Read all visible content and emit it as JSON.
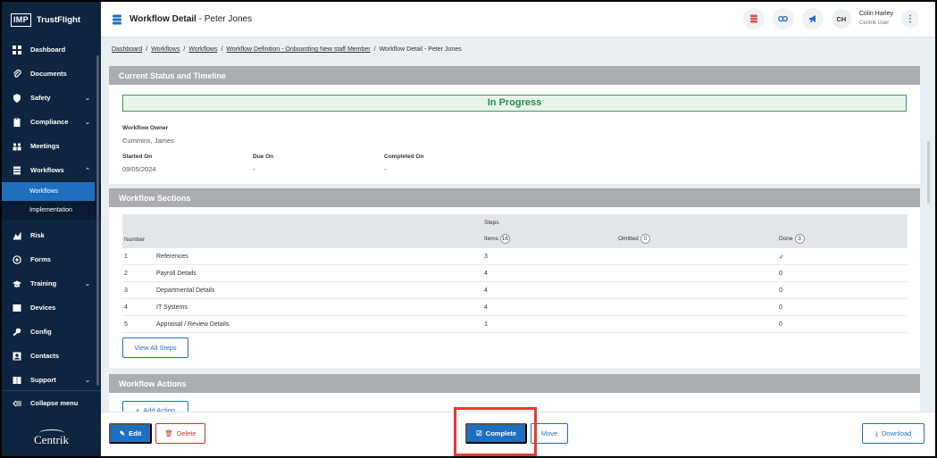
{
  "brand": {
    "logo": "IMP",
    "name": "TrustFlight"
  },
  "sidebar": {
    "items": [
      {
        "label": "Dashboard",
        "icon": "dashboard-icon"
      },
      {
        "label": "Documents",
        "icon": "paperclip-icon"
      },
      {
        "label": "Safety",
        "icon": "shield-icon",
        "chevron": "⌄"
      },
      {
        "label": "Compliance",
        "icon": "clipboard-icon",
        "chevron": "⌄"
      },
      {
        "label": "Meetings",
        "icon": "meetings-icon"
      },
      {
        "label": "Workflows",
        "icon": "workflows-icon",
        "chevron": "⌃"
      },
      {
        "label": "Risk",
        "icon": "risk-icon"
      },
      {
        "label": "Forms",
        "icon": "forms-icon"
      },
      {
        "label": "Training",
        "icon": "graduation-cap-icon",
        "chevron": "⌄"
      },
      {
        "label": "Devices",
        "icon": "devices-icon"
      },
      {
        "label": "Config",
        "icon": "config-icon"
      },
      {
        "label": "Contacts",
        "icon": "contacts-icon"
      },
      {
        "label": "Support",
        "icon": "support-icon",
        "chevron": "⌄"
      }
    ],
    "sub_items": [
      {
        "label": "Workflows",
        "active": true
      },
      {
        "label": "Implementation",
        "active": false
      }
    ],
    "collapse_label": "Collapse menu",
    "footer_logo": "Centrik"
  },
  "header": {
    "title": "Workflow Detail",
    "subtitle": " - Peter Jones",
    "user": {
      "initials": "CH",
      "name": "Colin Harley",
      "role": "Centrik User"
    }
  },
  "breadcrumb": {
    "items": [
      "Dashboard",
      "Workflows",
      "Workflows",
      "Workflow Definition - Onboarding New staff Member"
    ],
    "current": "Workflow Detail - Peter Jones",
    "sep": "/"
  },
  "status_panel": {
    "heading": "Current Status and Timeline",
    "status": "In Progress",
    "owner_label": "Workflow Owner",
    "owner_value": "Cummins, James",
    "started_label": "Started On",
    "started_value": "09/05/2024",
    "due_label": "Due On",
    "due_value": "-",
    "completed_label": "Completed On",
    "completed_value": "-"
  },
  "sections_panel": {
    "heading": "Workflow Sections",
    "steps_label": "Steps",
    "col_number": "Number",
    "col_items": "Items",
    "items_count": "16",
    "col_omitted": "Omitted",
    "omitted_count": "0",
    "col_done": "Done",
    "done_count": "3",
    "rows": [
      {
        "number": "1",
        "name": "References",
        "items": "3",
        "done": "✓"
      },
      {
        "number": "2",
        "name": "Payroll Details",
        "items": "4",
        "done": "0"
      },
      {
        "number": "3",
        "name": "Departmental Details",
        "items": "4",
        "done": "0"
      },
      {
        "number": "4",
        "name": "IT Systems",
        "items": "4",
        "done": "0"
      },
      {
        "number": "5",
        "name": "Appraisal / Review Details",
        "items": "1",
        "done": "0"
      }
    ],
    "view_all_label": "View All Steps"
  },
  "actions_panel": {
    "heading": "Workflow Actions",
    "add_action_label": "Add Action"
  },
  "footer": {
    "edit_label": "Edit",
    "delete_label": "Delete",
    "complete_label": "Complete",
    "move_label": "Move",
    "download_label": "Download"
  },
  "colors": {
    "sidebar_bg": "#0e2540",
    "primary": "#1f6fbf",
    "status_green": "#2f8a49",
    "danger": "#c0392b",
    "highlight": "#e53935"
  }
}
